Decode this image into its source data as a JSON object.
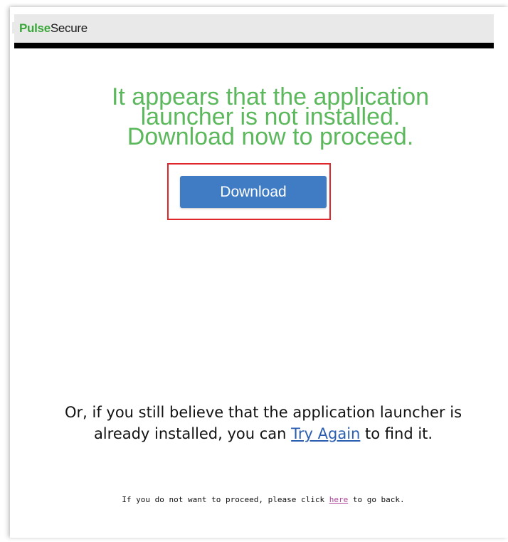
{
  "brand": {
    "name_part1": "Pulse",
    "name_part2": "Secure",
    "accent_green": "#3aa63a"
  },
  "message": {
    "line1": "It appears that the application",
    "line2": "launcher is not installed.",
    "line3": "Download now to proceed.",
    "color": "#5cb85c"
  },
  "download": {
    "label": "Download",
    "color": "#3f7cc4",
    "highlight_color": "#e0262b"
  },
  "retry": {
    "line1": "Or, if you still believe that the application launcher is",
    "line2_before": "already installed, you can ",
    "link_label": "Try Again",
    "line2_after": " to find it."
  },
  "back": {
    "before": "If you do not want to proceed, please click ",
    "link_label": "here",
    "after": " to go back."
  }
}
